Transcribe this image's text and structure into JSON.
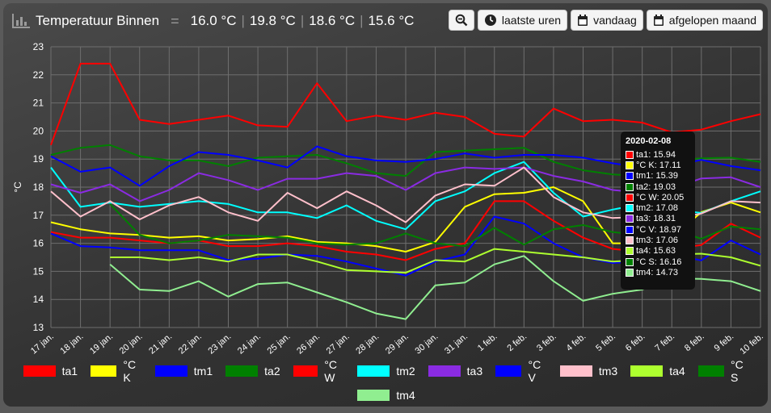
{
  "header": {
    "title": "Temperatuur Binnen",
    "readings": [
      "16.0 °C",
      "19.8 °C",
      "18.6 °C",
      "15.6 °C"
    ]
  },
  "toolbar": {
    "zoom_icon": "zoom-out-icon",
    "recent_label": "laatste uren",
    "today_label": "vandaag",
    "month_label": "afgelopen maand"
  },
  "colors": {
    "ta1": "#ff0000",
    "ck": "#ffff00",
    "tm1": "#0000ff",
    "ta2": "#008000",
    "cw": "#ff0000",
    "tm2": "#00ffff",
    "ta3": "#8a2be2",
    "cv": "#0000ff",
    "tm3": "#ffc0cb",
    "ta4": "#adff2f",
    "cs": "#008000",
    "tm4": "#90ee90"
  },
  "tooltip": {
    "date": "2020-02-08",
    "rows": [
      {
        "name": "ta1",
        "value": "15.94",
        "color": "#ff0000"
      },
      {
        "name": "°C K",
        "value": "17.11",
        "color": "#ffff00"
      },
      {
        "name": "tm1",
        "value": "15.39",
        "color": "#0000ff"
      },
      {
        "name": "ta2",
        "value": "19.03",
        "color": "#008000"
      },
      {
        "name": "°C W",
        "value": "20.05",
        "color": "#ff0000"
      },
      {
        "name": "tm2",
        "value": "17.08",
        "color": "#00ffff"
      },
      {
        "name": "ta3",
        "value": "18.31",
        "color": "#8a2be2"
      },
      {
        "name": "°C V",
        "value": "18.97",
        "color": "#0000ff"
      },
      {
        "name": "tm3",
        "value": "17.06",
        "color": "#ffc0cb"
      },
      {
        "name": "ta4",
        "value": "15.63",
        "color": "#adff2f"
      },
      {
        "name": "°C S",
        "value": "16.16",
        "color": "#008000"
      },
      {
        "name": "tm4",
        "value": "14.73",
        "color": "#90ee90"
      }
    ]
  },
  "chart_data": {
    "type": "line",
    "ylabel": "°C",
    "ylim": [
      13,
      23
    ],
    "yticks": [
      13,
      14,
      15,
      16,
      17,
      18,
      19,
      20,
      21,
      22,
      23
    ],
    "grid": true,
    "legend_position": "bottom",
    "x": [
      "17 jan.",
      "18 jan.",
      "19 jan.",
      "20 jan.",
      "21 jan.",
      "22 jan.",
      "23 jan.",
      "24 jan.",
      "25 jan.",
      "26 jan.",
      "27 jan.",
      "28 jan.",
      "29 jan.",
      "30 jan.",
      "31 jan.",
      "1 feb.",
      "2 feb.",
      "3 feb.",
      "4 feb.",
      "5 feb.",
      "6 feb.",
      "7 feb.",
      "8 feb.",
      "9 feb.",
      "10 feb."
    ],
    "series": [
      {
        "name": "ta1",
        "color": "#ff0000",
        "values": [
          16.4,
          16.2,
          16.2,
          16.1,
          16.0,
          16.1,
          15.9,
          15.9,
          16.0,
          15.9,
          15.7,
          15.6,
          15.4,
          15.8,
          16.0,
          17.5,
          17.5,
          16.8,
          16.2,
          15.8,
          15.7,
          15.8,
          15.94,
          16.7,
          16.2
        ]
      },
      {
        "name": "°C K",
        "color": "#ffff00",
        "values": [
          16.75,
          16.5,
          16.35,
          16.3,
          16.2,
          16.25,
          16.1,
          16.15,
          16.25,
          16.05,
          16.0,
          15.9,
          15.7,
          16.05,
          17.3,
          17.75,
          17.8,
          18.0,
          17.5,
          16.0,
          16.0,
          16.2,
          17.11,
          17.45,
          17.1
        ]
      },
      {
        "name": "tm1",
        "color": "#0000ff",
        "values": [
          16.35,
          15.9,
          15.85,
          15.75,
          15.75,
          15.75,
          15.4,
          15.45,
          15.6,
          15.55,
          15.35,
          15.1,
          14.85,
          15.35,
          15.6,
          16.95,
          16.7,
          16.0,
          15.5,
          15.3,
          15.35,
          15.6,
          15.39,
          16.1,
          15.6
        ]
      },
      {
        "name": "ta2",
        "color": "#008000",
        "values": [
          19.15,
          19.4,
          19.5,
          19.1,
          18.95,
          18.95,
          18.75,
          19.05,
          19.1,
          19.15,
          18.85,
          18.5,
          18.4,
          19.25,
          19.3,
          19.35,
          19.4,
          18.9,
          18.6,
          18.45,
          18.4,
          18.95,
          19.03,
          19.05,
          18.9
        ]
      },
      {
        "name": "°C W",
        "color": "#ff0000",
        "values": [
          19.5,
          22.4,
          22.4,
          20.4,
          20.25,
          20.4,
          20.55,
          20.2,
          20.15,
          21.7,
          20.35,
          20.55,
          20.4,
          20.65,
          20.5,
          19.9,
          19.8,
          20.8,
          20.35,
          20.4,
          20.3,
          19.95,
          20.05,
          20.35,
          20.6
        ]
      },
      {
        "name": "tm2",
        "color": "#00ffff",
        "values": [
          18.7,
          17.3,
          17.45,
          17.3,
          17.4,
          17.5,
          17.4,
          17.1,
          17.1,
          16.9,
          17.35,
          16.8,
          16.5,
          17.5,
          17.85,
          18.5,
          18.9,
          17.8,
          16.95,
          17.2,
          17.4,
          17.2,
          17.08,
          17.5,
          17.85
        ]
      },
      {
        "name": "ta3",
        "color": "#8a2be2",
        "values": [
          18.1,
          17.8,
          18.1,
          17.5,
          17.9,
          18.5,
          18.25,
          17.9,
          18.3,
          18.3,
          18.5,
          18.4,
          17.9,
          18.5,
          18.7,
          18.65,
          18.7,
          18.4,
          18.2,
          17.9,
          17.8,
          17.95,
          18.31,
          18.35,
          18.0
        ]
      },
      {
        "name": "°C V",
        "color": "#0000ff",
        "values": [
          19.1,
          18.55,
          18.7,
          18.05,
          18.75,
          19.25,
          19.15,
          18.95,
          18.7,
          19.45,
          19.1,
          18.95,
          18.9,
          19.0,
          19.2,
          19.05,
          19.15,
          19.15,
          19.05,
          18.85,
          18.7,
          18.75,
          18.97,
          18.75,
          18.6
        ]
      },
      {
        "name": "tm3",
        "color": "#ffc0cb",
        "values": [
          17.85,
          16.95,
          17.5,
          16.85,
          17.35,
          17.65,
          17.1,
          16.8,
          17.8,
          17.25,
          17.85,
          17.35,
          16.75,
          17.7,
          18.1,
          18.05,
          18.7,
          17.65,
          17.1,
          16.9,
          16.95,
          16.85,
          17.06,
          17.5,
          17.45
        ]
      },
      {
        "name": "ta4",
        "color": "#adff2f",
        "values": [
          null,
          null,
          15.5,
          15.5,
          15.4,
          15.5,
          15.35,
          15.6,
          15.6,
          15.35,
          15.05,
          15.0,
          14.95,
          15.4,
          15.35,
          15.8,
          15.7,
          15.6,
          15.5,
          15.35,
          15.4,
          15.6,
          15.63,
          15.5,
          15.2
        ]
      },
      {
        "name": "°C S",
        "color": "#008000",
        "values": [
          null,
          null,
          17.4,
          16.3,
          16.0,
          16.1,
          16.3,
          16.25,
          16.2,
          16.0,
          15.95,
          16.0,
          16.35,
          16.0,
          15.9,
          16.55,
          15.95,
          16.5,
          16.65,
          16.4,
          16.3,
          16.5,
          16.16,
          16.6,
          16.5
        ]
      },
      {
        "name": "tm4",
        "color": "#90ee90",
        "values": [
          null,
          null,
          15.25,
          14.35,
          14.3,
          14.65,
          14.1,
          14.55,
          14.6,
          14.25,
          13.9,
          13.5,
          13.3,
          14.5,
          14.6,
          15.25,
          15.55,
          14.65,
          13.95,
          14.2,
          14.35,
          14.75,
          14.73,
          14.65,
          14.3
        ]
      }
    ]
  }
}
